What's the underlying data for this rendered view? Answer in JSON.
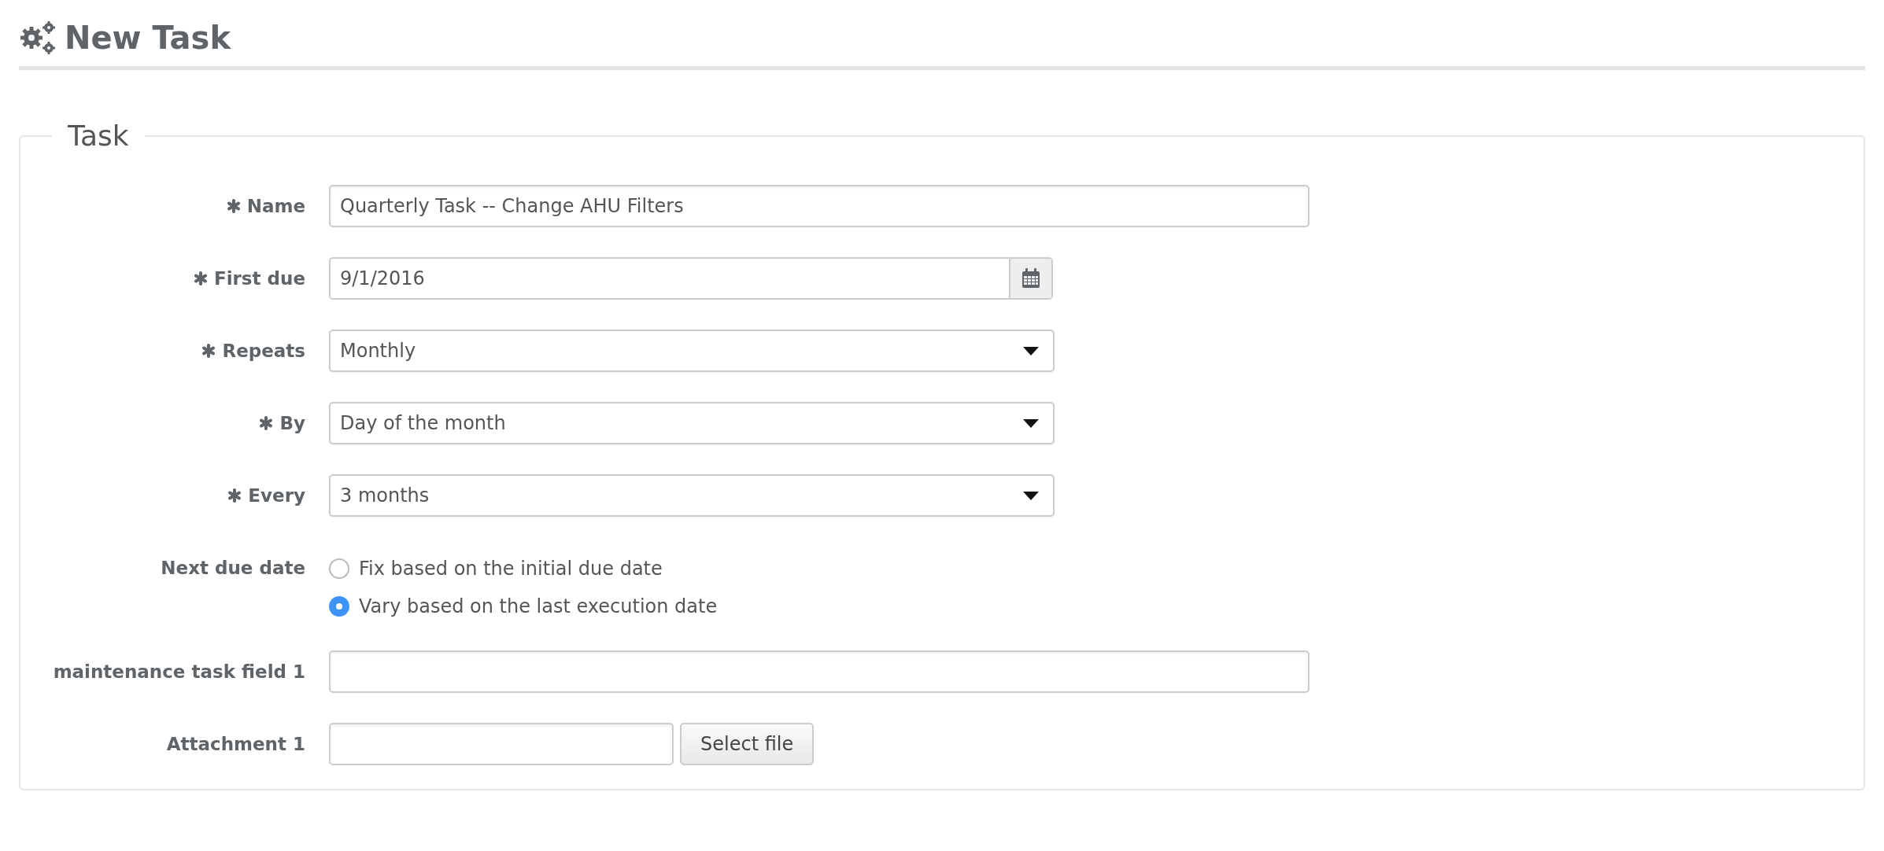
{
  "page": {
    "title": "New Task"
  },
  "section": {
    "legend": "Task",
    "fields": [
      {
        "kind": "text",
        "label": "Name",
        "required": true,
        "value": "Quarterly Task -- Change AHU Filters"
      },
      {
        "kind": "date",
        "label": "First due",
        "required": true,
        "value": "9/1/2016"
      },
      {
        "kind": "select",
        "label": "Repeats",
        "required": true,
        "value": "Monthly"
      },
      {
        "kind": "select",
        "label": "By",
        "required": true,
        "value": "Day of the month"
      },
      {
        "kind": "select",
        "label": "Every",
        "required": true,
        "value": "3 months"
      },
      {
        "kind": "radio",
        "label": "Next due date",
        "required": false,
        "options": [
          {
            "label": "Fix based on the initial due date",
            "selected": false
          },
          {
            "label": "Vary based on the last execution date",
            "selected": true
          }
        ]
      },
      {
        "kind": "text",
        "label": "maintenance task field 1",
        "required": false
      },
      {
        "kind": "file",
        "label": "Attachment 1",
        "required": false,
        "button": "Select file"
      }
    ]
  }
}
